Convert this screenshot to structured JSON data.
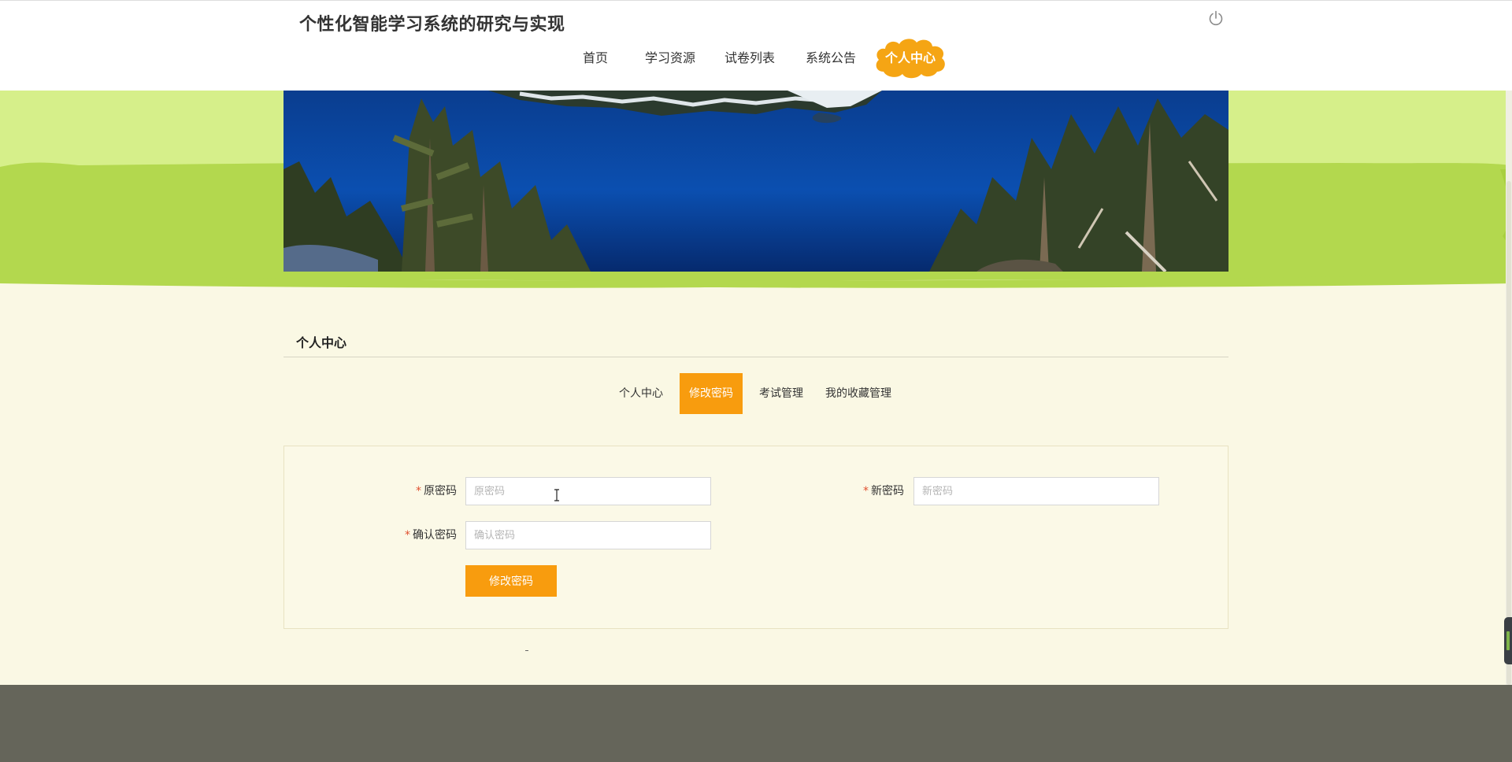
{
  "header": {
    "site_title": "个性化智能学习系统的研究与实现",
    "power_icon": "power-icon"
  },
  "nav": {
    "items": [
      {
        "label": "首页"
      },
      {
        "label": "学习资源"
      },
      {
        "label": "试卷列表"
      },
      {
        "label": "系统公告"
      },
      {
        "label": "个人中心",
        "active": true
      }
    ]
  },
  "personal_center": {
    "title": "个人中心",
    "tabs": [
      {
        "label": "个人中心"
      },
      {
        "label": "修改密码",
        "active": true
      },
      {
        "label": "考试管理"
      },
      {
        "label": "我的收藏管理"
      }
    ]
  },
  "form": {
    "required_mark": "*",
    "old_password": {
      "label": "原密码",
      "placeholder": "原密码",
      "value": ""
    },
    "new_password": {
      "label": "新密码",
      "placeholder": "新密码",
      "value": ""
    },
    "confirm_password": {
      "label": "确认密码",
      "placeholder": "确认密码",
      "value": ""
    },
    "submit_label": "修改密码"
  },
  "colors": {
    "accent": "#f89c0e",
    "banner_green_light": "#d6ef8a",
    "banner_green": "#b3d84e",
    "page_bg": "#faf8e4",
    "footer": "#65655a"
  }
}
